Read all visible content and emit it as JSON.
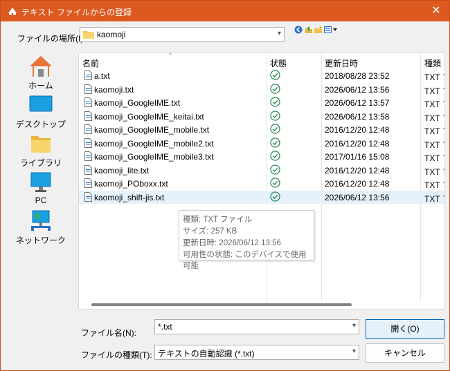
{
  "window": {
    "title": "テキスト ファイルからの登録",
    "close_glyph": "✕"
  },
  "lookin": {
    "label": "ファイルの場所(I):",
    "value": "kaomoji"
  },
  "toolbar": {
    "icons": [
      "back-icon",
      "up-folder-icon",
      "new-folder-icon",
      "view-menu-icon"
    ]
  },
  "places": [
    {
      "label": "ホーム",
      "icon": "home-icon"
    },
    {
      "label": "デスクトップ",
      "icon": "desktop-icon"
    },
    {
      "label": "ライブラリ",
      "icon": "library-folder-icon"
    },
    {
      "label": "PC",
      "icon": "pc-icon"
    },
    {
      "label": "ネットワーク",
      "icon": "network-icon"
    }
  ],
  "columns": {
    "name": "名前",
    "status": "状態",
    "modified": "更新日時",
    "type": "種類"
  },
  "files": [
    {
      "name": "a.txt",
      "modified": "2018/08/28 23:52",
      "type": "TXT ファイル"
    },
    {
      "name": "kaomoji.txt",
      "modified": "2026/06/12 13:56",
      "type": "TXT ファイル"
    },
    {
      "name": "kaomoji_GoogleIME.txt",
      "modified": "2026/06/12 13:57",
      "type": "TXT ファイル"
    },
    {
      "name": "kaomoji_GoogleIME_keitai.txt",
      "modified": "2026/06/12 13:58",
      "type": "TXT ファイル"
    },
    {
      "name": "kaomoji_GoogleIME_mobile.txt",
      "modified": "2016/12/20 12:48",
      "type": "TXT ファイル"
    },
    {
      "name": "kaomoji_GoogleIME_mobile2.txt",
      "modified": "2016/12/20 12:48",
      "type": "TXT ファイル"
    },
    {
      "name": "kaomoji_GoogleIME_mobile3.txt",
      "modified": "2017/01/16 15:08",
      "type": "TXT ファイル"
    },
    {
      "name": "kaomoji_lite.txt",
      "modified": "2016/12/20 12:48",
      "type": "TXT ファイル"
    },
    {
      "name": "kaomoji_POboxx.txt",
      "modified": "2016/12/20 12:48",
      "type": "TXT ファイル"
    },
    {
      "name": "kaomoji_shift-jis.txt",
      "modified": "2026/06/12 13:56",
      "type": "TXT ファイル",
      "selected": true
    }
  ],
  "tooltip": {
    "type_line": "種類: TXT ファイル",
    "size_line": "サイズ: 257 KB",
    "modified_line": "更新日時: 2026/06/12 13:56",
    "availability_line": "可用性の状態: このデバイスで使用可能"
  },
  "filename": {
    "label": "ファイル名(N):",
    "value": "*.txt"
  },
  "filetype": {
    "label": "ファイルの種類(T):",
    "value": "テキストの自動認識 (*.txt)"
  },
  "buttons": {
    "open": "開く(O)",
    "cancel": "キャンセル"
  },
  "colors": {
    "titlebar": "#dc5a1f",
    "status_ok": "#2e8b57",
    "selection": "#e5f1fb",
    "accent": "#0067c0"
  }
}
